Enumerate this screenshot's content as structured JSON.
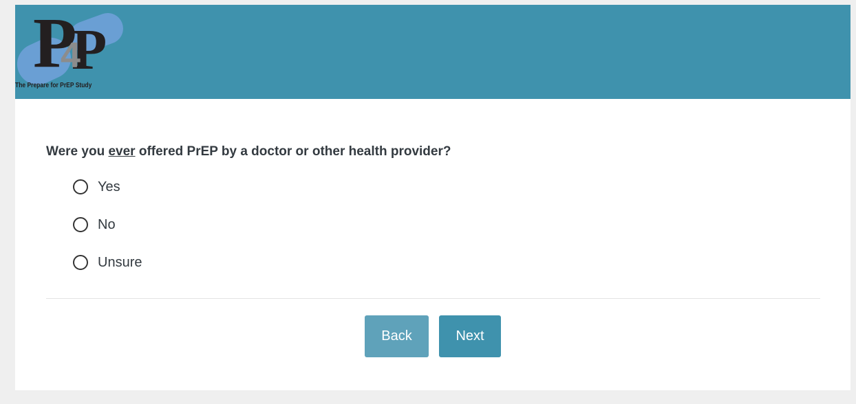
{
  "header": {
    "logo_letter_1": "P",
    "logo_digit": "4",
    "logo_letter_2": "P",
    "logo_tagline": "The Prepare for PrEP Study",
    "background_color": "#3f92ad"
  },
  "question": {
    "text_before": "Were you ",
    "emphasis": "ever",
    "text_after": " offered PrEP by a doctor or other health provider?"
  },
  "options": [
    {
      "label": "Yes",
      "selected": false
    },
    {
      "label": "No",
      "selected": false
    },
    {
      "label": "Unsure",
      "selected": false
    }
  ],
  "navigation": {
    "back_label": "Back",
    "next_label": "Next",
    "back_color": "#5fa2ba",
    "next_color": "#3f92ad"
  }
}
